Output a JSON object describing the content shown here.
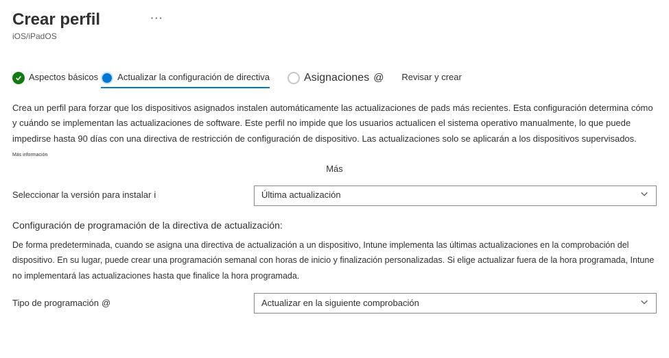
{
  "header": {
    "title": "Crear perfil",
    "subtitle": "iOS/iPadOS",
    "more": "···"
  },
  "steps": {
    "s1": "Aspectos básicos",
    "s2": "Actualizar la configuración de directiva",
    "s3": "Asignaciones",
    "s4": "Revisar y crear"
  },
  "desc": "Crea un perfil para forzar que los dispositivos asignados instalen automáticamente las actualizaciones de pads más recientes. Esta configuración determina cómo y cuándo se implementan las actualizaciones de software. Este perfil no impide que los usuarios actualicen el sistema operativo manualmente, lo que puede impedirse hasta 90 días con una directiva de restricción de configuración de dispositivo. Las actualizaciones solo se aplicarán a los dispositivos supervisados.",
  "more_info_small": "Más información",
  "more_label": "Más",
  "version": {
    "label": "Seleccionar la versión para instalar",
    "selected": "Última actualización"
  },
  "schedule": {
    "heading": "Configuración de programación de la directiva de actualización:",
    "desc": "De forma predeterminada, cuando se asigna una directiva de actualización a un dispositivo, Intune implementa las últimas actualizaciones en la comprobación del dispositivo. En su lugar, puede crear una programación semanal con horas de inicio y finalización personalizadas. Si elige actualizar fuera de la hora programada, Intune no implementará las actualizaciones hasta que finalice la hora programada.",
    "type_label": "Tipo de programación",
    "type_selected": "Actualizar en la siguiente comprobación"
  },
  "icons": {
    "info_glyph": "i",
    "at_glyph": "@"
  }
}
